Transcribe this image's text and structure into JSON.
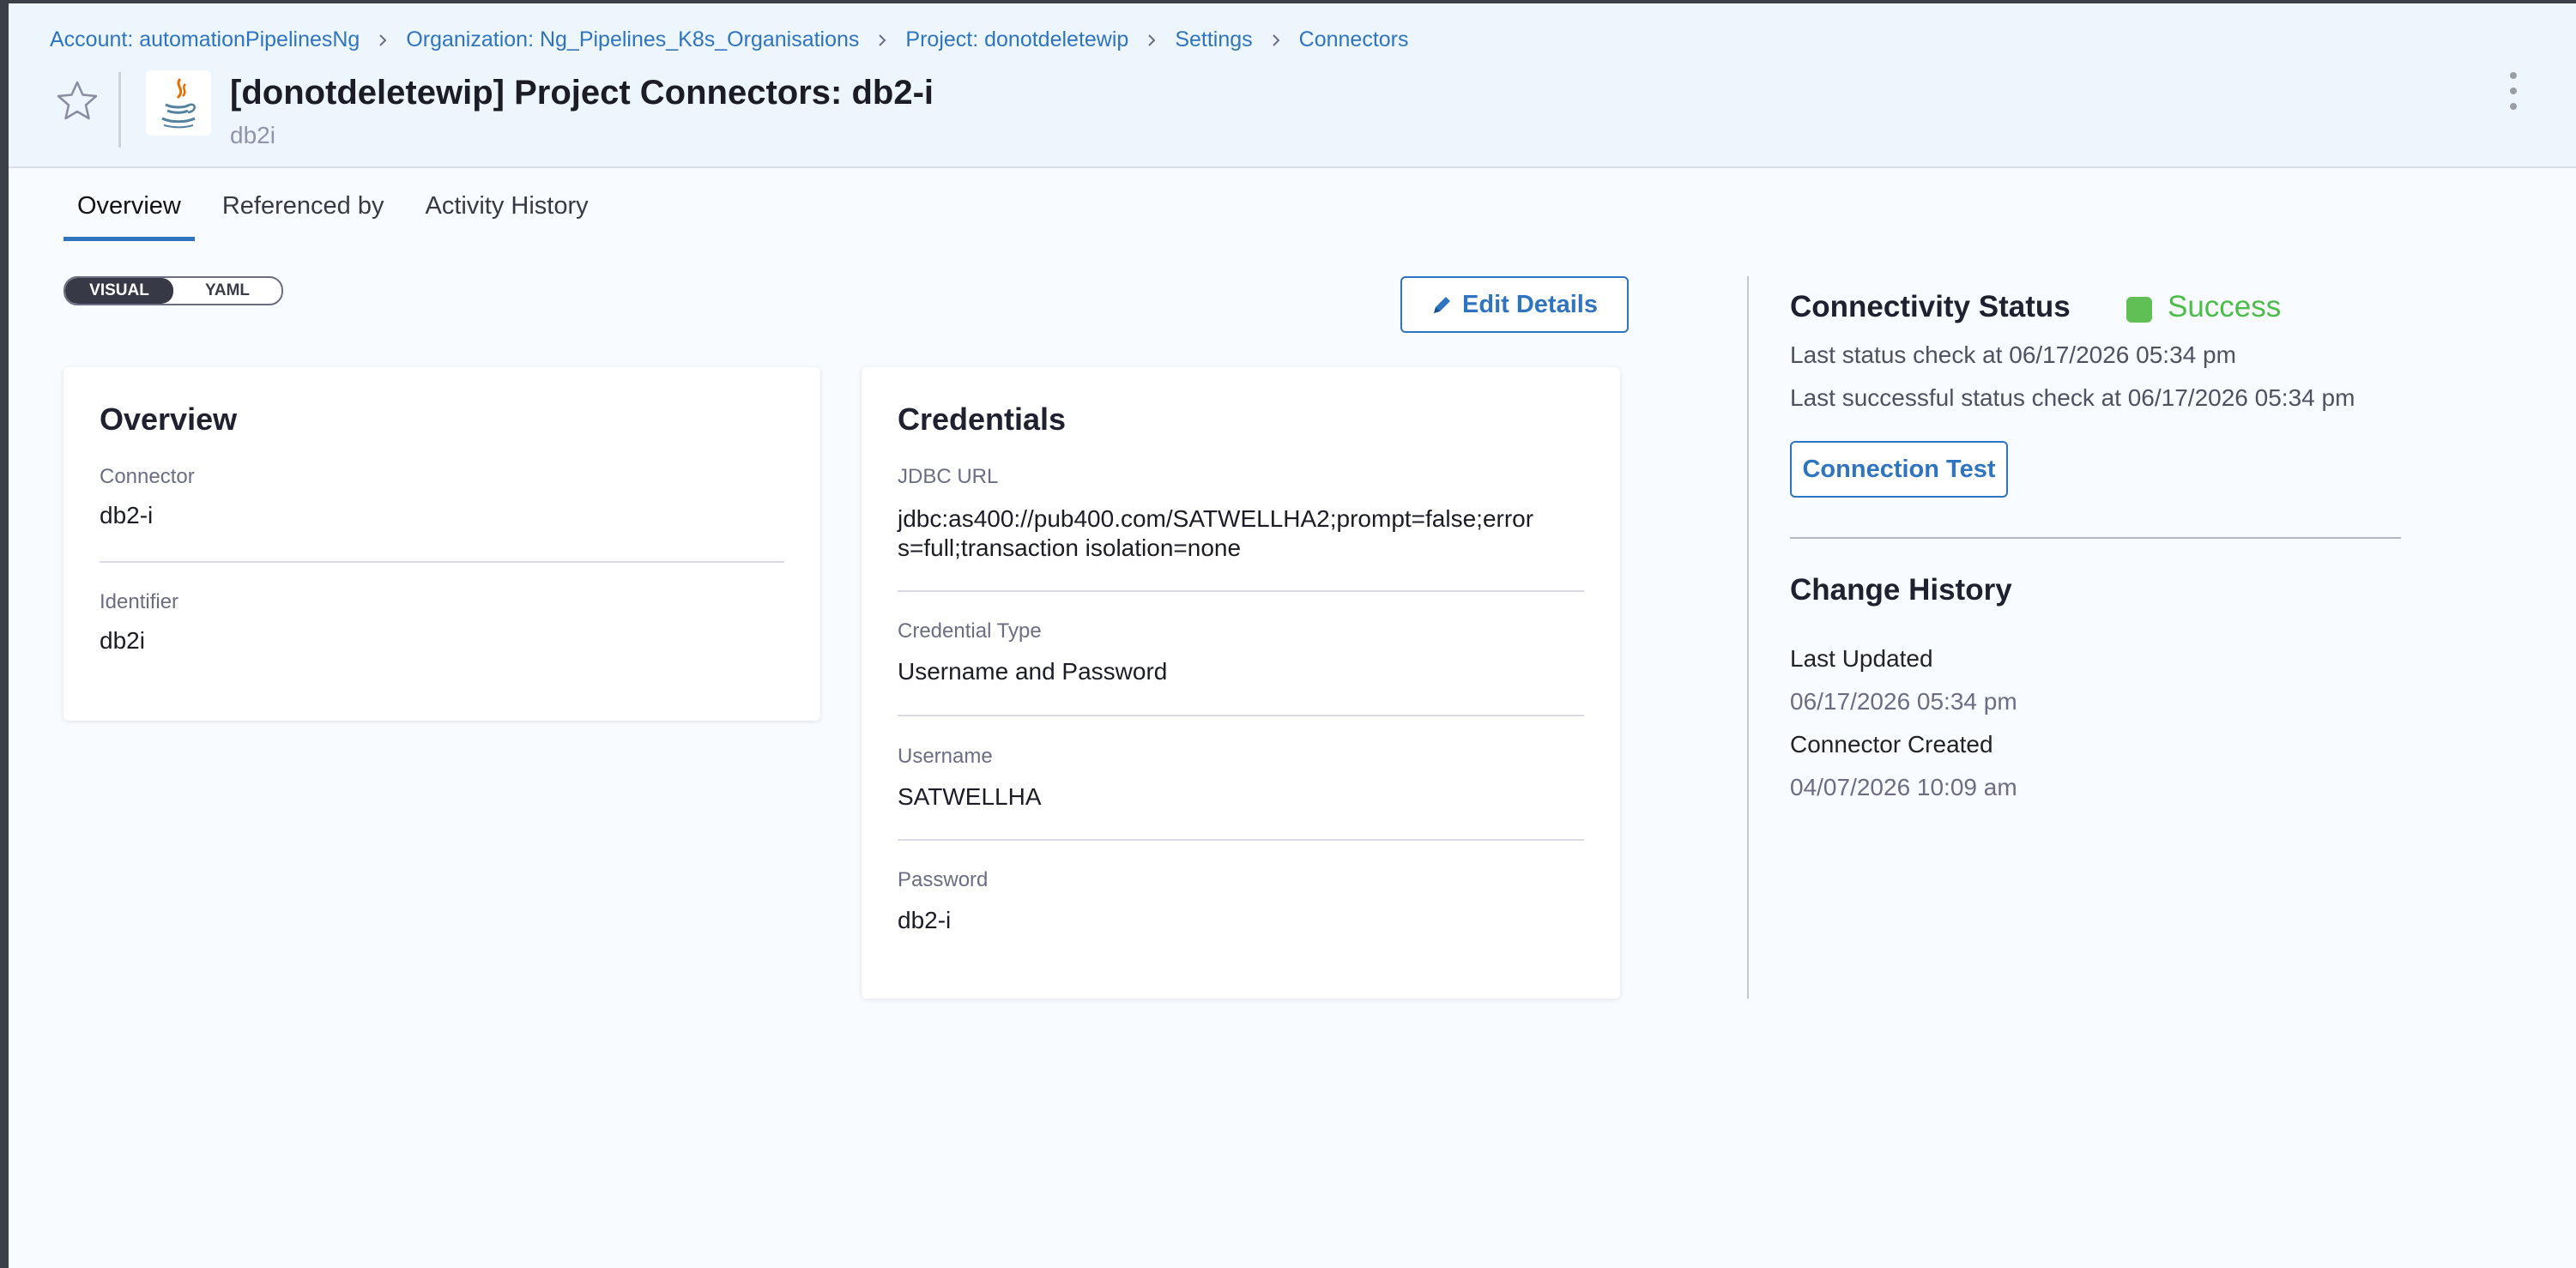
{
  "breadcrumb": [
    {
      "label": "Account: automationPipelinesNg"
    },
    {
      "label": "Organization: Ng_Pipelines_K8s_Organisations"
    },
    {
      "label": "Project: donotdeletewip"
    },
    {
      "label": "Settings"
    },
    {
      "label": "Connectors"
    }
  ],
  "header": {
    "title": "[donotdeletewip] Project Connectors: db2-i",
    "subtitle": "db2i",
    "logo_icon": "java-icon",
    "star_icon": "star-outline-icon",
    "menu_icon": "kebab-menu-icon"
  },
  "tabs": [
    {
      "label": "Overview",
      "active": true
    },
    {
      "label": "Referenced by",
      "active": false
    },
    {
      "label": "Activity History",
      "active": false
    }
  ],
  "view_toggle": {
    "visual": "VISUAL",
    "yaml": "YAML",
    "selected": "VISUAL"
  },
  "edit_button": {
    "label": "Edit Details",
    "icon": "pencil-icon"
  },
  "overview_card": {
    "title": "Overview",
    "connector_label": "Connector",
    "connector_value": "db2-i",
    "identifier_label": "Identifier",
    "identifier_value": "db2i"
  },
  "credentials_card": {
    "title": "Credentials",
    "jdbc_label": "JDBC URL",
    "jdbc_line1": "jdbc:as400://pub400.com/SATWELLHA2;prompt=false;error",
    "jdbc_line2": "s=full;transaction isolation=none",
    "credential_type_label": "Credential Type",
    "credential_type_value": "Username and Password",
    "username_label": "Username",
    "username_value": "SATWELLHA",
    "password_label": "Password",
    "password_value": "db2-i"
  },
  "connectivity": {
    "title": "Connectivity Status",
    "status": "Success",
    "status_color": "#4dbd49",
    "last_check": "Last status check at 06/17/2026 05:34 pm",
    "last_success": "Last successful status check at 06/17/2026 05:34 pm",
    "test_button": "Connection Test"
  },
  "change_history": {
    "title": "Change History",
    "last_updated_label": "Last Updated",
    "last_updated_value": "06/17/2026 05:34 pm",
    "created_label": "Connector Created",
    "created_value": "04/07/2026 10:09 am"
  },
  "colors": {
    "accent": "#2f74c0",
    "header_bg": "#edf6fd",
    "page_bg": "#f8fbff"
  }
}
